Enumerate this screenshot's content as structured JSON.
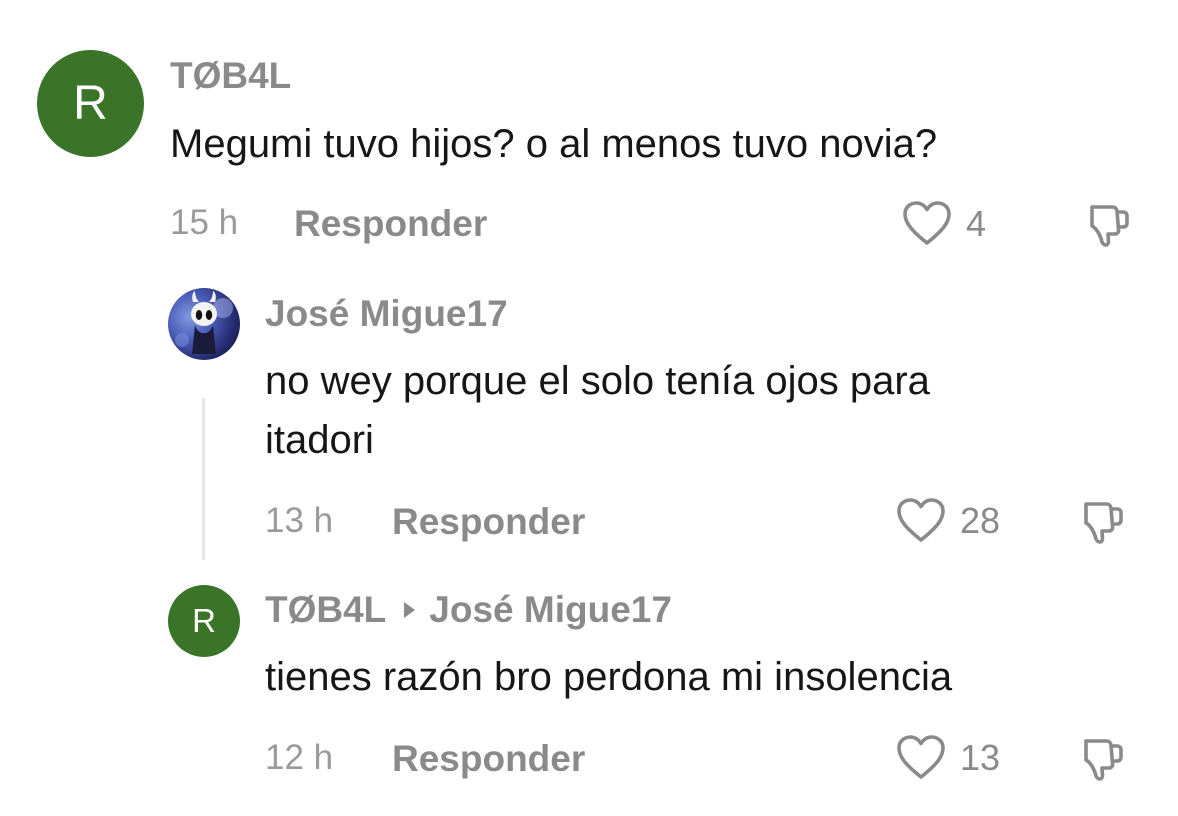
{
  "comments": [
    {
      "avatar_letter": "R",
      "avatar_color": "#3a7428",
      "username": "TØB4L",
      "text": "Megumi tuvo hijos? o al menos tuvo novia?",
      "time": "15 h",
      "reply_label": "Responder",
      "likes": "4"
    },
    {
      "username": "José Migue17",
      "text_line1": "no wey porque el solo tenía ojos para",
      "text_line2": "itadori",
      "time": "13 h",
      "reply_label": "Responder",
      "likes": "28"
    },
    {
      "avatar_letter": "R",
      "avatar_color": "#3a7428",
      "username": "TØB4L",
      "reply_to": "José Migue17",
      "text": "tienes razón bro perdona mi insolencia",
      "time": "12 h",
      "reply_label": "Responder",
      "likes": "13"
    }
  ],
  "icons": {
    "like": "heart-outline-icon",
    "dislike": "thumbs-down-outline-icon",
    "reply_arrow": "triangle-right-icon"
  }
}
